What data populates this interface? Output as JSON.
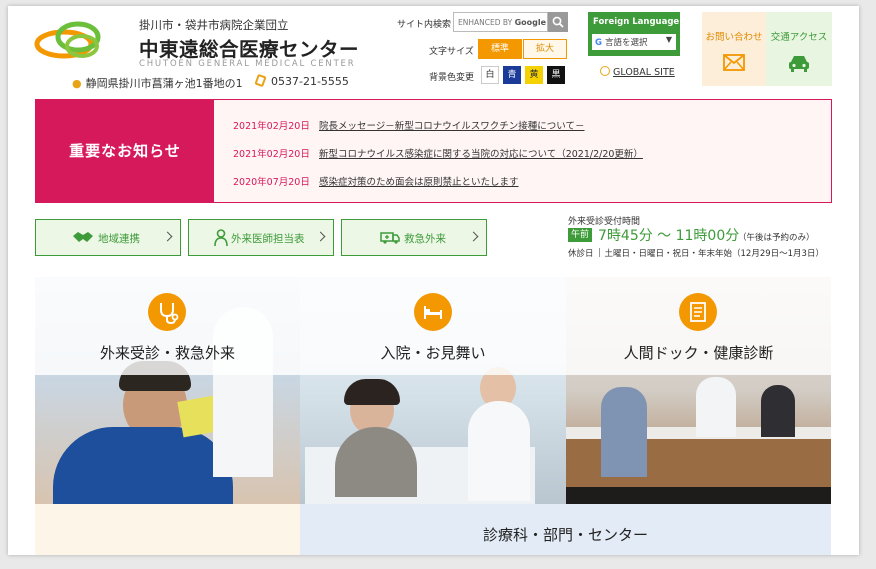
{
  "header": {
    "organization": "掛川市・袋井市病院企業団立",
    "hospital_name": "中東遠総合医療センター",
    "hospital_name_en": "CHUTOEN GENERAL MEDICAL CENTER",
    "address": "静岡県掛川市菖蒲ヶ池1番地の1",
    "phone": "0537-21-5555"
  },
  "tools": {
    "site_search_label": "サイト内検索",
    "search_enhanced": "ENHANCED BY",
    "search_brand": "Google",
    "font_size_label": "文字サイズ",
    "font_standard": "標準",
    "font_large": "拡大",
    "bg_color_label": "背景色変更",
    "bg_options": [
      "白",
      "青",
      "黄",
      "黒"
    ],
    "foreign_language_title": "Foreign Language",
    "language_select": "言語を選択",
    "global_site": "GLOBAL SITE",
    "contact": "お問い合わせ",
    "access": "交通アクセス"
  },
  "notice": {
    "heading": "重要なお知らせ",
    "items": [
      {
        "date": "2021年02月20日",
        "title": "院長メッセージ－新型コロナウイルスワクチン接種について－"
      },
      {
        "date": "2021年02月20日",
        "title": "新型コロナウイルス感染症に関する当院の対応について（2021/2/20更新）"
      },
      {
        "date": "2020年07月20日",
        "title": "感染症対策のため面会は原則禁止といたします"
      }
    ]
  },
  "quick_nav": [
    {
      "label": "地域連携"
    },
    {
      "label": "外来医師担当表"
    },
    {
      "label": "救急外来"
    }
  ],
  "hours": {
    "heading": "外来受診受付時間",
    "badge": "午前",
    "time": "7時45分 ～ 11時00分",
    "note": "（午後は予約のみ）",
    "holiday_label": "休診日",
    "holidays": "土曜日・日曜日・祝日・年末年始（12月29日～1月3日）"
  },
  "tiles": [
    {
      "title": "外来受診・救急外来"
    },
    {
      "title": "入院・お見舞い"
    },
    {
      "title": "人間ドック・健康診断"
    }
  ],
  "bottom": {
    "departments": "診療科・部門・センター"
  },
  "colors": {
    "brand_green": "#3e9b3a",
    "accent_orange": "#f39800",
    "notice_red": "#d6195b"
  }
}
